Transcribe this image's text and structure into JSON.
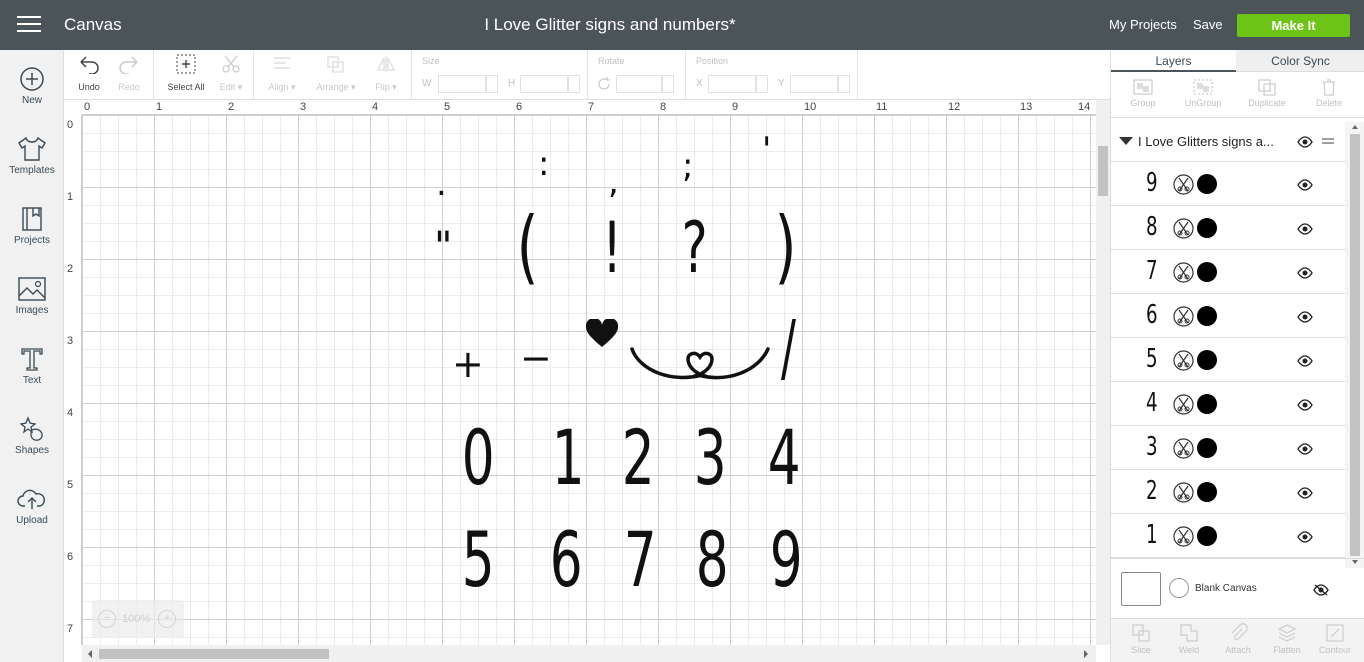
{
  "header": {
    "app_title": "Canvas",
    "doc_title": "I Love Glitter signs and numbers*",
    "my_projects": "My Projects",
    "save": "Save",
    "make_it": "Make It"
  },
  "sidebar": {
    "items": [
      {
        "label": "New",
        "icon": "plus-circle-icon"
      },
      {
        "label": "Templates",
        "icon": "shirt-icon"
      },
      {
        "label": "Projects",
        "icon": "book-icon"
      },
      {
        "label": "Images",
        "icon": "image-icon"
      },
      {
        "label": "Text",
        "icon": "text-icon"
      },
      {
        "label": "Shapes",
        "icon": "shapes-icon"
      },
      {
        "label": "Upload",
        "icon": "upload-cloud-icon"
      }
    ]
  },
  "toolbar": {
    "undo": "Undo",
    "redo": "Redo",
    "select_all": "Select All",
    "edit": "Edit",
    "align": "Align",
    "arrange": "Arrange",
    "flip": "Flip",
    "size": "Size",
    "w": "W",
    "h": "H",
    "rotate": "Rotate",
    "position": "Position",
    "x": "X",
    "y": "Y"
  },
  "ruler": {
    "top": [
      "0",
      "1",
      "2",
      "3",
      "4",
      "5",
      "6",
      "7",
      "8",
      "9",
      "10",
      "11",
      "12",
      "13",
      "14"
    ],
    "left": [
      "0",
      "1",
      "2",
      "3",
      "4",
      "5",
      "6",
      "7"
    ]
  },
  "zoom": {
    "minus": "−",
    "level": "100%",
    "plus": "+"
  },
  "canvas_glyphs": {
    "row1": [
      ".",
      ":",
      ",",
      ";",
      "'"
    ],
    "row2": [
      "\"",
      "(",
      "!",
      "?",
      ")"
    ],
    "row3": [
      "+",
      "−",
      "/"
    ],
    "row4": [
      "0",
      "1",
      "2",
      "3",
      "4"
    ],
    "row5": [
      "5",
      "6",
      "7",
      "8",
      "9"
    ]
  },
  "panel": {
    "tabs": [
      "Layers",
      "Color Sync"
    ],
    "tools": [
      "Group",
      "UnGroup",
      "Duplicate",
      "Delete"
    ],
    "group_name": "I Love Glitters signs a...",
    "layers": [
      "9",
      "8",
      "7",
      "6",
      "5",
      "4",
      "3",
      "2",
      "1"
    ],
    "blank_canvas": "Blank Canvas",
    "bottom_tools": [
      "Slice",
      "Weld",
      "Attach",
      "Flatten",
      "Contour"
    ]
  }
}
